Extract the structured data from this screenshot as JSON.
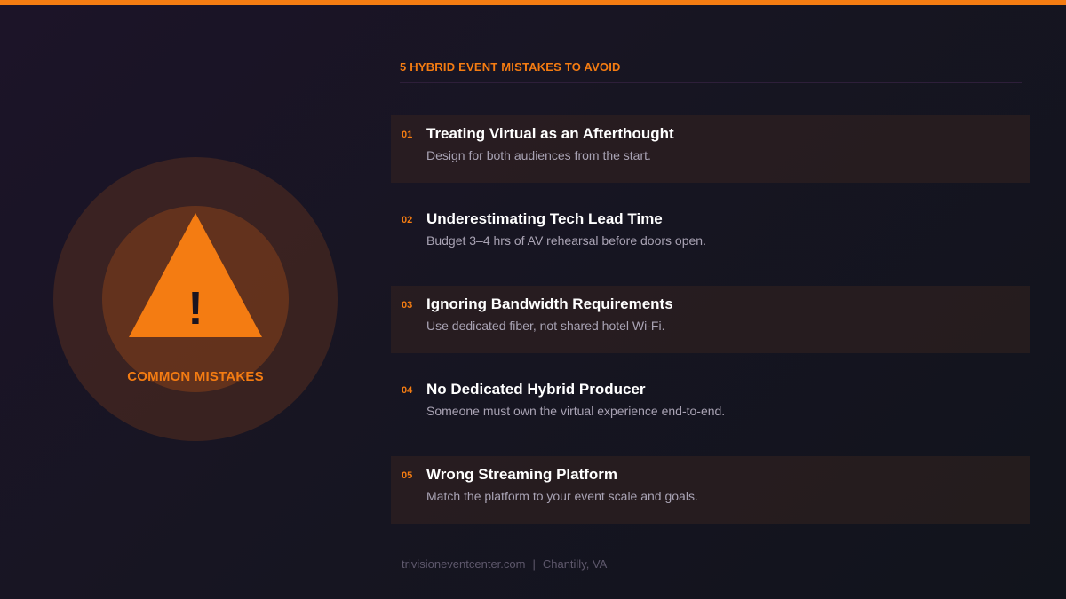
{
  "colors": {
    "accent": "#f47c12",
    "title": "#ffffff",
    "description": "#a9a3b4",
    "footer": "#5e586c"
  },
  "hero": {
    "icon": "warning-triangle-icon",
    "symbol": "!",
    "label": "COMMON MISTAKES"
  },
  "section_title": "5 HYBRID EVENT MISTAKES TO AVOID",
  "items": [
    {
      "num": "01",
      "title": "Treating Virtual as an Afterthought",
      "desc": "Design for both audiences from the start."
    },
    {
      "num": "02",
      "title": "Underestimating Tech Lead Time",
      "desc": "Budget 3–4 hrs of AV rehearsal before doors open."
    },
    {
      "num": "03",
      "title": "Ignoring Bandwidth Requirements",
      "desc": "Use dedicated fiber, not shared hotel Wi-Fi."
    },
    {
      "num": "04",
      "title": "No Dedicated Hybrid Producer",
      "desc": "Someone must own the virtual experience end-to-end."
    },
    {
      "num": "05",
      "title": "Wrong Streaming Platform",
      "desc": "Match the platform to your event scale and goals."
    }
  ],
  "footer": {
    "website": "trivisioneventcenter.com",
    "separator": "|",
    "location": "Chantilly, VA"
  }
}
